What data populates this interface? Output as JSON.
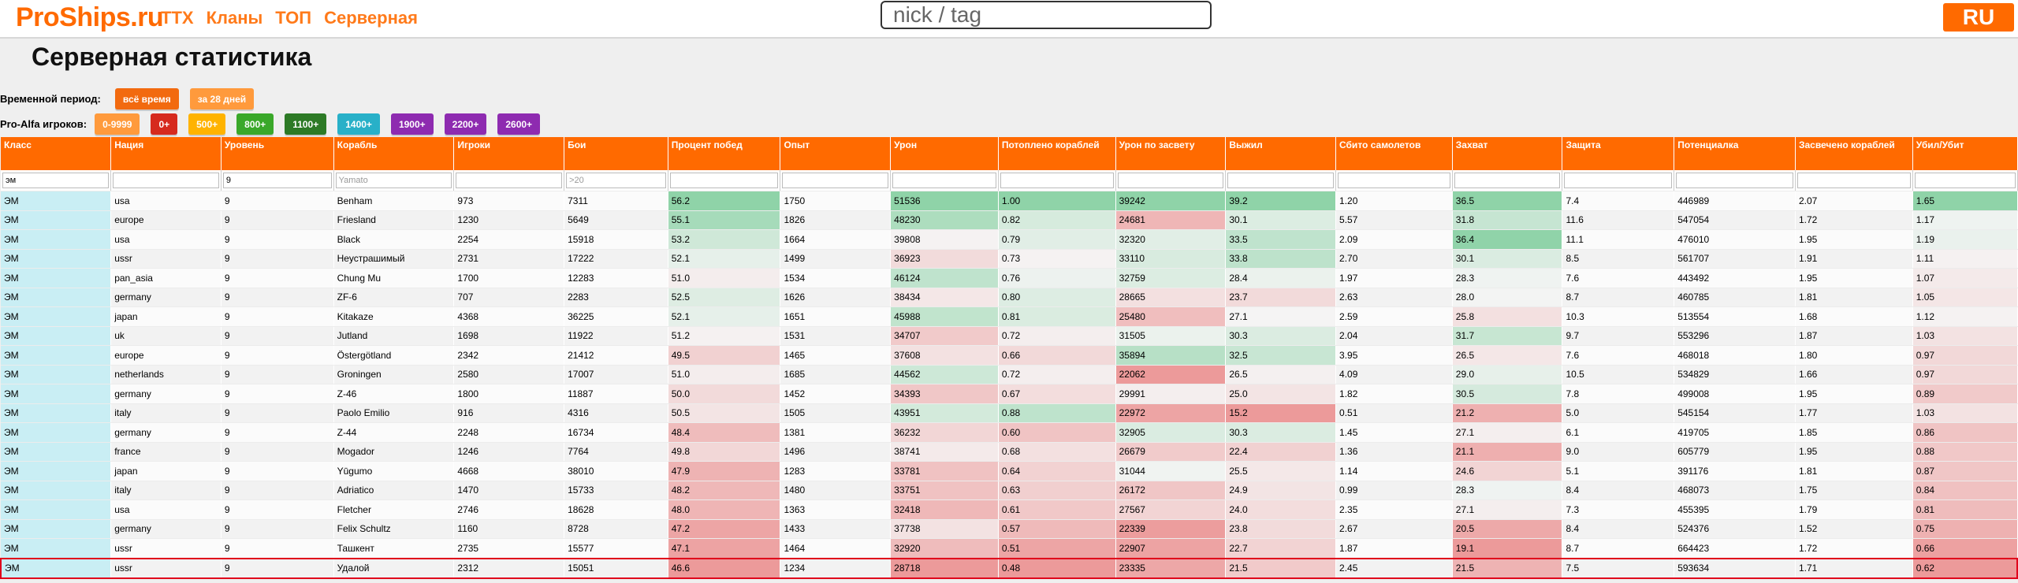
{
  "header": {
    "logo": "ProShips.ru",
    "nav": [
      "ТТХ",
      "Кланы",
      "ТОП",
      "Серверная"
    ],
    "search_placeholder": "nick / tag",
    "lang": "RU"
  },
  "page_title": "Серверная статистика",
  "period": {
    "label": "Временной период:",
    "buttons": [
      {
        "label": "всё время",
        "color": "#f26a0f",
        "active": true
      },
      {
        "label": "за 28 дней",
        "color": "#ff9a3c",
        "active": false
      }
    ]
  },
  "pro_alfa": {
    "label": "Pro-Alfa игроков:",
    "buttons": [
      {
        "label": "0-9999",
        "color": "#ff9a3c"
      },
      {
        "label": "0+",
        "color": "#d62a1e"
      },
      {
        "label": "500+",
        "color": "#ffb300"
      },
      {
        "label": "800+",
        "color": "#3aa82a"
      },
      {
        "label": "1100+",
        "color": "#2d7a26"
      },
      {
        "label": "1400+",
        "color": "#28b0c8"
      },
      {
        "label": "1900+",
        "color": "#8e2bb0"
      },
      {
        "label": "2200+",
        "color": "#8e2bb0"
      },
      {
        "label": "2600+",
        "color": "#8e2bb0"
      }
    ]
  },
  "table": {
    "columns": [
      "Класс",
      "Нация",
      "Уровень",
      "Корабль",
      "Игроки",
      "Бои",
      "Процент побед",
      "Опыт",
      "Урон",
      "Потоплено кораблей",
      "Урон по засвету",
      "Выжил",
      "Сбито самолетов",
      "Захват",
      "Защита",
      "Потенциалка",
      "Засвечено кораблей",
      "Убил/Убит"
    ],
    "filters": [
      {
        "value": "эм",
        "placeholder": ""
      },
      {
        "value": "",
        "placeholder": ""
      },
      {
        "value": "9",
        "placeholder": ""
      },
      {
        "value": "",
        "placeholder": "Yamato"
      },
      {
        "value": "",
        "placeholder": ""
      },
      {
        "value": "",
        "placeholder": ">20"
      },
      {
        "value": "",
        "placeholder": ""
      },
      {
        "value": "",
        "placeholder": ""
      },
      {
        "value": "",
        "placeholder": ""
      },
      {
        "value": "",
        "placeholder": ""
      },
      {
        "value": "",
        "placeholder": ""
      },
      {
        "value": "",
        "placeholder": ""
      },
      {
        "value": "",
        "placeholder": ""
      },
      {
        "value": "",
        "placeholder": ""
      },
      {
        "value": "",
        "placeholder": ""
      },
      {
        "value": "",
        "placeholder": ""
      },
      {
        "value": "",
        "placeholder": ""
      },
      {
        "value": "",
        "placeholder": ""
      }
    ],
    "rows": [
      [
        "ЭМ",
        "usa",
        "9",
        "Benham",
        "973",
        "7311",
        "56.2",
        "1750",
        "51536",
        "1.00",
        "39242",
        "39.2",
        "1.20",
        "36.5",
        "7.4",
        "446989",
        "2.07",
        "1.65"
      ],
      [
        "ЭМ",
        "europe",
        "9",
        "Friesland",
        "1230",
        "5649",
        "55.1",
        "1826",
        "48230",
        "0.82",
        "24681",
        "30.1",
        "5.57",
        "31.8",
        "11.6",
        "547054",
        "1.72",
        "1.17"
      ],
      [
        "ЭМ",
        "usa",
        "9",
        "Black",
        "2254",
        "15918",
        "53.2",
        "1664",
        "39808",
        "0.79",
        "32320",
        "33.5",
        "2.09",
        "36.4",
        "11.1",
        "476010",
        "1.95",
        "1.19"
      ],
      [
        "ЭМ",
        "ussr",
        "9",
        "Неустрашимый",
        "2731",
        "17222",
        "52.1",
        "1499",
        "36923",
        "0.73",
        "33110",
        "33.8",
        "2.70",
        "30.1",
        "8.5",
        "561707",
        "1.91",
        "1.11"
      ],
      [
        "ЭМ",
        "pan_asia",
        "9",
        "Chung Mu",
        "1700",
        "12283",
        "51.0",
        "1534",
        "46124",
        "0.76",
        "32759",
        "28.4",
        "1.97",
        "28.3",
        "7.6",
        "443492",
        "1.95",
        "1.07"
      ],
      [
        "ЭМ",
        "germany",
        "9",
        "ZF-6",
        "707",
        "2283",
        "52.5",
        "1626",
        "38434",
        "0.80",
        "28665",
        "23.7",
        "2.63",
        "28.0",
        "8.7",
        "460785",
        "1.81",
        "1.05"
      ],
      [
        "ЭМ",
        "japan",
        "9",
        "Kitakaze",
        "4368",
        "36225",
        "52.1",
        "1651",
        "45988",
        "0.81",
        "25480",
        "27.1",
        "2.59",
        "25.8",
        "10.3",
        "513554",
        "1.68",
        "1.12"
      ],
      [
        "ЭМ",
        "uk",
        "9",
        "Jutland",
        "1698",
        "11922",
        "51.2",
        "1531",
        "34707",
        "0.72",
        "31505",
        "30.3",
        "2.04",
        "31.7",
        "9.7",
        "553296",
        "1.87",
        "1.03"
      ],
      [
        "ЭМ",
        "europe",
        "9",
        "Östergötland",
        "2342",
        "21412",
        "49.5",
        "1465",
        "37608",
        "0.66",
        "35894",
        "32.5",
        "3.95",
        "26.5",
        "7.6",
        "468018",
        "1.80",
        "0.97"
      ],
      [
        "ЭМ",
        "netherlands",
        "9",
        "Groningen",
        "2580",
        "17007",
        "51.0",
        "1685",
        "44562",
        "0.72",
        "22062",
        "26.5",
        "4.09",
        "29.0",
        "10.5",
        "534829",
        "1.66",
        "0.97"
      ],
      [
        "ЭМ",
        "germany",
        "9",
        "Z-46",
        "1800",
        "11887",
        "50.0",
        "1452",
        "34393",
        "0.67",
        "29991",
        "25.0",
        "1.82",
        "30.5",
        "7.8",
        "499008",
        "1.95",
        "0.89"
      ],
      [
        "ЭМ",
        "italy",
        "9",
        "Paolo Emilio",
        "916",
        "4316",
        "50.5",
        "1505",
        "43951",
        "0.88",
        "22972",
        "15.2",
        "0.51",
        "21.2",
        "5.0",
        "545154",
        "1.77",
        "1.03"
      ],
      [
        "ЭМ",
        "germany",
        "9",
        "Z-44",
        "2248",
        "16734",
        "48.4",
        "1381",
        "36232",
        "0.60",
        "32905",
        "30.3",
        "1.45",
        "27.1",
        "6.1",
        "419705",
        "1.85",
        "0.86"
      ],
      [
        "ЭМ",
        "france",
        "9",
        "Mogador",
        "1246",
        "7764",
        "49.8",
        "1496",
        "38741",
        "0.68",
        "26679",
        "22.4",
        "1.36",
        "21.1",
        "9.0",
        "605779",
        "1.95",
        "0.88"
      ],
      [
        "ЭМ",
        "japan",
        "9",
        "Yūgumo",
        "4668",
        "38010",
        "47.9",
        "1283",
        "33781",
        "0.64",
        "31044",
        "25.5",
        "1.14",
        "24.6",
        "5.1",
        "391176",
        "1.81",
        "0.87"
      ],
      [
        "ЭМ",
        "italy",
        "9",
        "Adriatico",
        "1470",
        "15733",
        "48.2",
        "1480",
        "33751",
        "0.63",
        "26172",
        "24.9",
        "0.99",
        "28.3",
        "8.4",
        "468073",
        "1.75",
        "0.84"
      ],
      [
        "ЭМ",
        "usa",
        "9",
        "Fletcher",
        "2746",
        "18628",
        "48.0",
        "1363",
        "32418",
        "0.61",
        "27567",
        "24.0",
        "2.35",
        "27.1",
        "7.3",
        "455395",
        "1.79",
        "0.81"
      ],
      [
        "ЭМ",
        "germany",
        "9",
        "Felix Schultz",
        "1160",
        "8728",
        "47.2",
        "1433",
        "37738",
        "0.57",
        "22339",
        "23.8",
        "2.67",
        "20.5",
        "8.4",
        "524376",
        "1.52",
        "0.75"
      ],
      [
        "ЭМ",
        "ussr",
        "9",
        "Ташкент",
        "2735",
        "15577",
        "47.1",
        "1464",
        "32920",
        "0.51",
        "22907",
        "22.7",
        "1.87",
        "19.1",
        "8.7",
        "664423",
        "1.72",
        "0.66"
      ],
      [
        "ЭМ",
        "ussr",
        "9",
        "Удалой",
        "2312",
        "15051",
        "46.6",
        "1234",
        "28718",
        "0.48",
        "23335",
        "21.5",
        "2.45",
        "21.5",
        "7.5",
        "593634",
        "1.71",
        "0.62"
      ]
    ],
    "highlight_row": 19,
    "colored_columns": [
      6,
      8,
      9,
      10,
      11,
      13,
      17
    ],
    "good_color": "#8fd3a8",
    "bad_color": "#ec9a9a"
  }
}
